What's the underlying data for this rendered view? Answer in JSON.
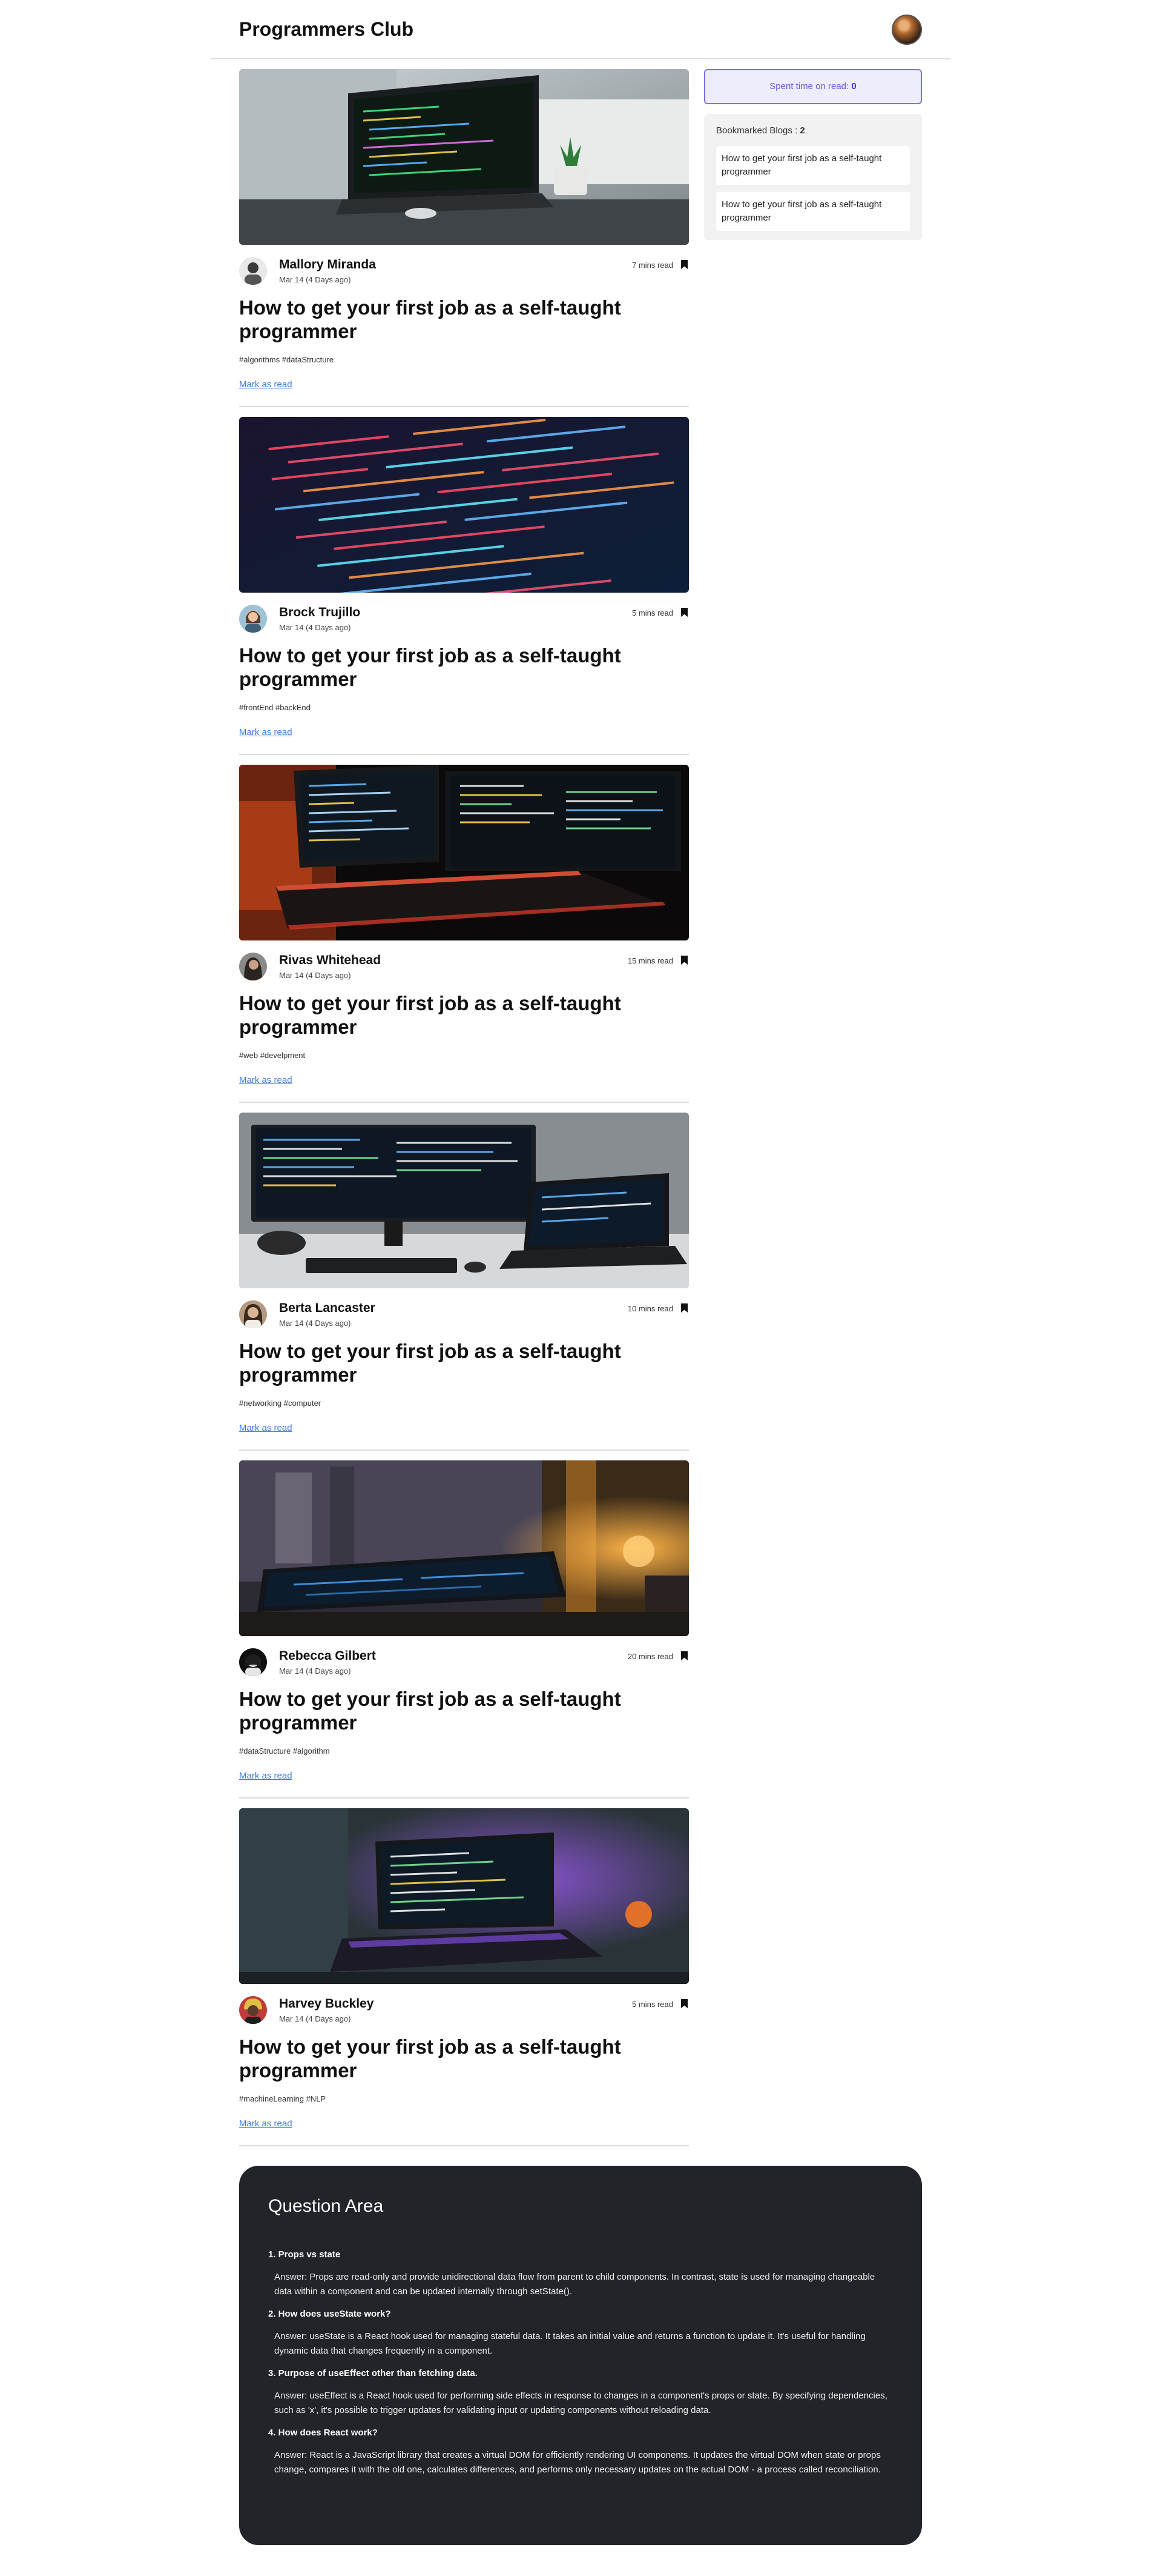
{
  "header": {
    "brand": "Programmers Club"
  },
  "sidebar": {
    "spent_label": "Spent time on read: ",
    "spent_value": "0",
    "bookmarked_label": "Bookmarked Blogs : ",
    "bookmarked_count": "2",
    "bookmarks": [
      "How to get your first job as a self-taught programmer",
      "How to get your first job as a self-taught programmer"
    ]
  },
  "blogs": [
    {
      "author": "Mallory Miranda",
      "date": "Mar 14 (4 Days ago)",
      "read_time": "7 mins read",
      "title": "How to get your first job as a self-taught programmer",
      "tags": "#algorithms #dataStructure",
      "mark": "Mark as read"
    },
    {
      "author": "Brock Trujillo",
      "date": "Mar 14 (4 Days ago)",
      "read_time": "5 mins read",
      "title": "How to get your first job as a self-taught programmer",
      "tags": "#frontEnd #backEnd",
      "mark": "Mark as read"
    },
    {
      "author": "Rivas Whitehead",
      "date": "Mar 14 (4 Days ago)",
      "read_time": "15 mins read",
      "title": "How to get your first job as a self-taught programmer",
      "tags": "#web #develpment",
      "mark": "Mark as read"
    },
    {
      "author": "Berta Lancaster",
      "date": "Mar 14 (4 Days ago)",
      "read_time": "10 mins read",
      "title": "How to get your first job as a self-taught programmer",
      "tags": "#networking #computer",
      "mark": "Mark as read"
    },
    {
      "author": "Rebecca Gilbert",
      "date": "Mar 14 (4 Days ago)",
      "read_time": "20 mins read",
      "title": "How to get your first job as a self-taught programmer",
      "tags": "#dataStructure #algorithm",
      "mark": "Mark as read"
    },
    {
      "author": "Harvey Buckley",
      "date": "Mar 14 (4 Days ago)",
      "read_time": "5 mins read",
      "title": "How to get your first job as a self-taught programmer",
      "tags": "#machineLearning #NLP",
      "mark": "Mark as read"
    }
  ],
  "qa": {
    "title": "Question Area",
    "items": [
      {
        "q": "1. Props vs state",
        "a": "Answer: Props are read-only and provide unidirectional data flow from parent to child components. In contrast, state is used for managing changeable data within a component and can be updated internally through setState()."
      },
      {
        "q": "2. How does useState work?",
        "a": "Answer: useState is a React hook used for managing stateful data. It takes an initial value and returns a function to update it. It's useful for handling dynamic data that changes frequently in a component."
      },
      {
        "q": "3. Purpose of useEffect other than fetching data.",
        "a": "Answer: useEffect is a React hook used for performing side effects in response to changes in a component's props or state. By specifying dependencies, such as 'x', it's possible to trigger updates for validating input or updating components without reloading data."
      },
      {
        "q": "4. How does React work?",
        "a": "Answer: React is a JavaScript library that creates a virtual DOM for efficiently rendering UI components. It updates the virtual DOM when state or props change, compares it with the old one, calculates differences, and performs only necessary updates on the actual DOM - a process called reconciliation."
      }
    ]
  }
}
